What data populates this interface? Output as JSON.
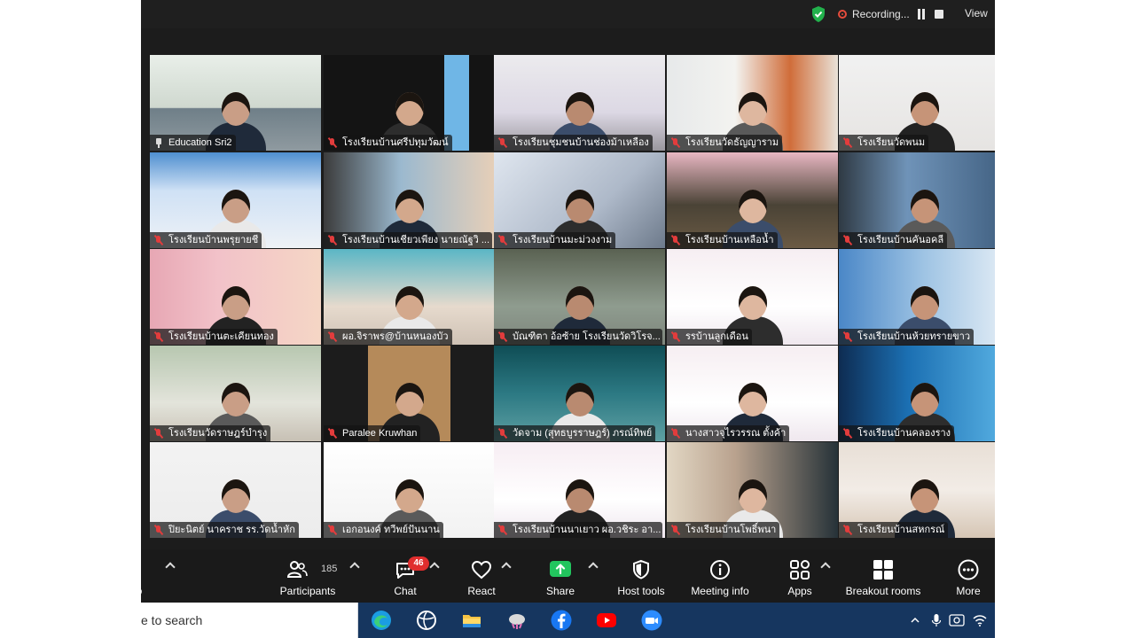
{
  "topbar": {
    "recording_label": "Recording...",
    "view_label": "View"
  },
  "participants": [
    {
      "name": "Education Sri2",
      "muted": false,
      "active": true
    },
    {
      "name": "โรงเรียนบ้านศรีปทุมวัฒน์",
      "muted": true
    },
    {
      "name": "โรงเรียนชุมชนบ้านช่องม้าเหลือง",
      "muted": true
    },
    {
      "name": "โรงเรียนวัดธัญญาราม",
      "muted": true
    },
    {
      "name": "โรงเรียนวัดพนม",
      "muted": true
    },
    {
      "name": "โรงเรียนบ้านพรุยายชี",
      "muted": true
    },
    {
      "name": "โรงเรียนบ้านเชียวเพียง นายณัฐวิ ...",
      "muted": true
    },
    {
      "name": "โรงเรียนบ้านมะม่วงงาม",
      "muted": true
    },
    {
      "name": "โรงเรียนบ้านเหลือน้ำ",
      "muted": true
    },
    {
      "name": "โรงเรียนบ้านคันอคลี",
      "muted": true
    },
    {
      "name": "โรงเรียนบ้านตะเคียนทอง",
      "muted": true
    },
    {
      "name": "ผอ.จิราพร@บ้านหนองบัว",
      "muted": true
    },
    {
      "name": "บัณฑิตา อ้อซ้าย โรงเรียนวัดวิโรจ...",
      "muted": true
    },
    {
      "name": "รรบ้านลูกเดือน",
      "muted": true
    },
    {
      "name": "โรงเรียนบ้านห้วยทรายขาว",
      "muted": true
    },
    {
      "name": "โรงเรียนวัดราษฎร์บำรุง",
      "muted": true
    },
    {
      "name": "Paralee Kruwhan",
      "muted": true
    },
    {
      "name": "วัดจาม (สุทธบูรราษฎร์) ภรณ์ทิพย์",
      "muted": true
    },
    {
      "name": "นางสาวจุไรวรรณ ตั้งค้า",
      "muted": true
    },
    {
      "name": "โรงเรียนบ้านคลองราง",
      "muted": true
    },
    {
      "name": "ปิยะนิตย์ นาคราช รร.วัดน้ำหัก",
      "muted": true
    },
    {
      "name": "เอกอนงค์ ทวีพย์ปันนาน",
      "muted": true
    },
    {
      "name": "โรงเรียนบ้านนาเยาว ผอ.วชิระ อา...",
      "muted": true
    },
    {
      "name": "โรงเรียนบ้านโพธิ์พนา",
      "muted": true
    },
    {
      "name": "โรงเรียนบ้านสหกรณ์",
      "muted": true
    }
  ],
  "toolbar": {
    "video_label": "eo",
    "participants_label": "Participants",
    "participants_count": "185",
    "chat_label": "Chat",
    "chat_badge": "46",
    "react_label": "React",
    "share_label": "Share",
    "host_tools_label": "Host tools",
    "meeting_info_label": "Meeting info",
    "apps_label": "Apps",
    "breakout_label": "Breakout rooms",
    "more_label": "More"
  },
  "taskbar": {
    "search_text": "e to search"
  },
  "colors": {
    "active_border": "#3fcf5f",
    "share_green": "#22c55e",
    "badge_red": "#e02d2d",
    "mute_red": "#e23c3c"
  }
}
